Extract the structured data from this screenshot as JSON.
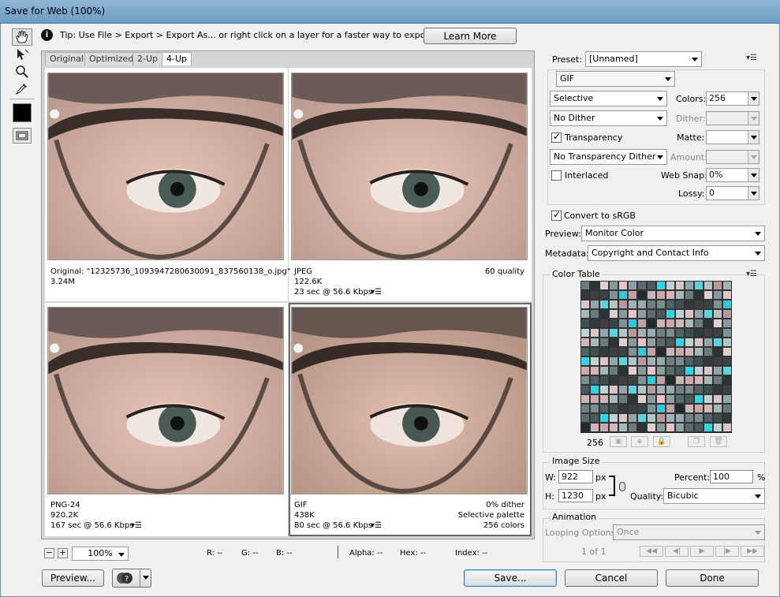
{
  "window": {
    "title": "Save for Web (100%)"
  },
  "tip": {
    "text": "Tip: Use File > Export > Export As...  or right click on a layer for a faster way to export assets",
    "button": "Learn More"
  },
  "tabs": [
    "Original",
    "Optimized",
    "2-Up",
    "4-Up"
  ],
  "panes": [
    {
      "line1": "Original: \"12325736_1093947280630091_837560138_o.jpg\"",
      "line2": "3.24M",
      "line3": "",
      "right1": "",
      "right2": "",
      "right3": ""
    },
    {
      "line1": "JPEG",
      "line2": "122.6K",
      "line3": "23 sec @ 56.6 Kbps",
      "right1": "60 quality",
      "right2": "",
      "right3": ""
    },
    {
      "line1": "PNG-24",
      "line2": "920.2K",
      "line3": "167 sec @ 56.6 Kbps",
      "right1": "",
      "right2": "",
      "right3": ""
    },
    {
      "line1": "GIF",
      "line2": "438K",
      "line3": "80 sec @ 56.6 Kbps",
      "right1": "0% dither",
      "right2": "Selective palette",
      "right3": "256 colors"
    }
  ],
  "statusbar": {
    "zoom": "100%",
    "r": "R: --",
    "g": "G: --",
    "b": "B: --",
    "alpha": "Alpha: --",
    "hex": "Hex: --",
    "index": "Index: --"
  },
  "settings": {
    "preset_label": "Preset:",
    "preset_value": "[Unnamed]",
    "format": "GIF",
    "reduction": "Selective",
    "colors_label": "Colors:",
    "colors_value": "256",
    "dither_algo": "No Dither",
    "dither_label": "Dither:",
    "dither_value": "",
    "transparency_label": "Transparency",
    "transparency_checked": true,
    "matte_label": "Matte:",
    "matte_value": "",
    "trans_dither": "No Transparency Dither",
    "amount_label": "Amount:",
    "amount_value": "",
    "interlaced_label": "Interlaced",
    "interlaced_checked": false,
    "websnap_label": "Web Snap:",
    "websnap_value": "0%",
    "lossy_label": "Lossy:",
    "lossy_value": "0",
    "srgb_label": "Convert to sRGB",
    "srgb_checked": true,
    "preview_label": "Preview:",
    "preview_value": "Monitor Color",
    "metadata_label": "Metadata:",
    "metadata_value": "Copyright and Contact Info"
  },
  "color_table": {
    "title": "Color Table",
    "count": "256"
  },
  "image_size": {
    "title": "Image Size",
    "w_label": "W:",
    "w_value": "922",
    "h_label": "H:",
    "h_value": "1230",
    "unit": "px",
    "percent_label": "Percent:",
    "percent_value": "100",
    "percent_unit": "%",
    "quality_label": "Quality:",
    "quality_value": "Bicubic"
  },
  "animation": {
    "title": "Animation",
    "looping_label": "Looping Options:",
    "looping_value": "Once",
    "frame": "1 of 1"
  },
  "buttons": {
    "preview": "Preview...",
    "save": "Save...",
    "cancel": "Cancel",
    "done": "Done"
  },
  "colors": {
    "accent": "#3c7fb1",
    "titlebar": "#7aa6cb",
    "panel_bg": "#f0f0f0"
  },
  "palette": [
    "#6b7c7e",
    "#3a4446",
    "#b59a9f",
    "#8fa0a4",
    "#c8b7b9",
    "#4f6164",
    "#d9c5c7",
    "#2a3436",
    "#7f9296",
    "#a5b2b5",
    "#5c6b6e",
    "#c9a7ab",
    "#3f5053",
    "#90a6aa",
    "#e0cfd0",
    "#36c6d6",
    "#98aaae",
    "#49595c",
    "#d2b5b8",
    "#2e3a3c",
    "#5fd0dc",
    "#86999c",
    "#bfa2a6",
    "#6d8084",
    "#34d3e3",
    "#a7b8bb",
    "#403f42",
    "#b3c4c6",
    "#e6c3c7",
    "#1f2a2c",
    "#7a8d90",
    "#c0d2d4"
  ]
}
